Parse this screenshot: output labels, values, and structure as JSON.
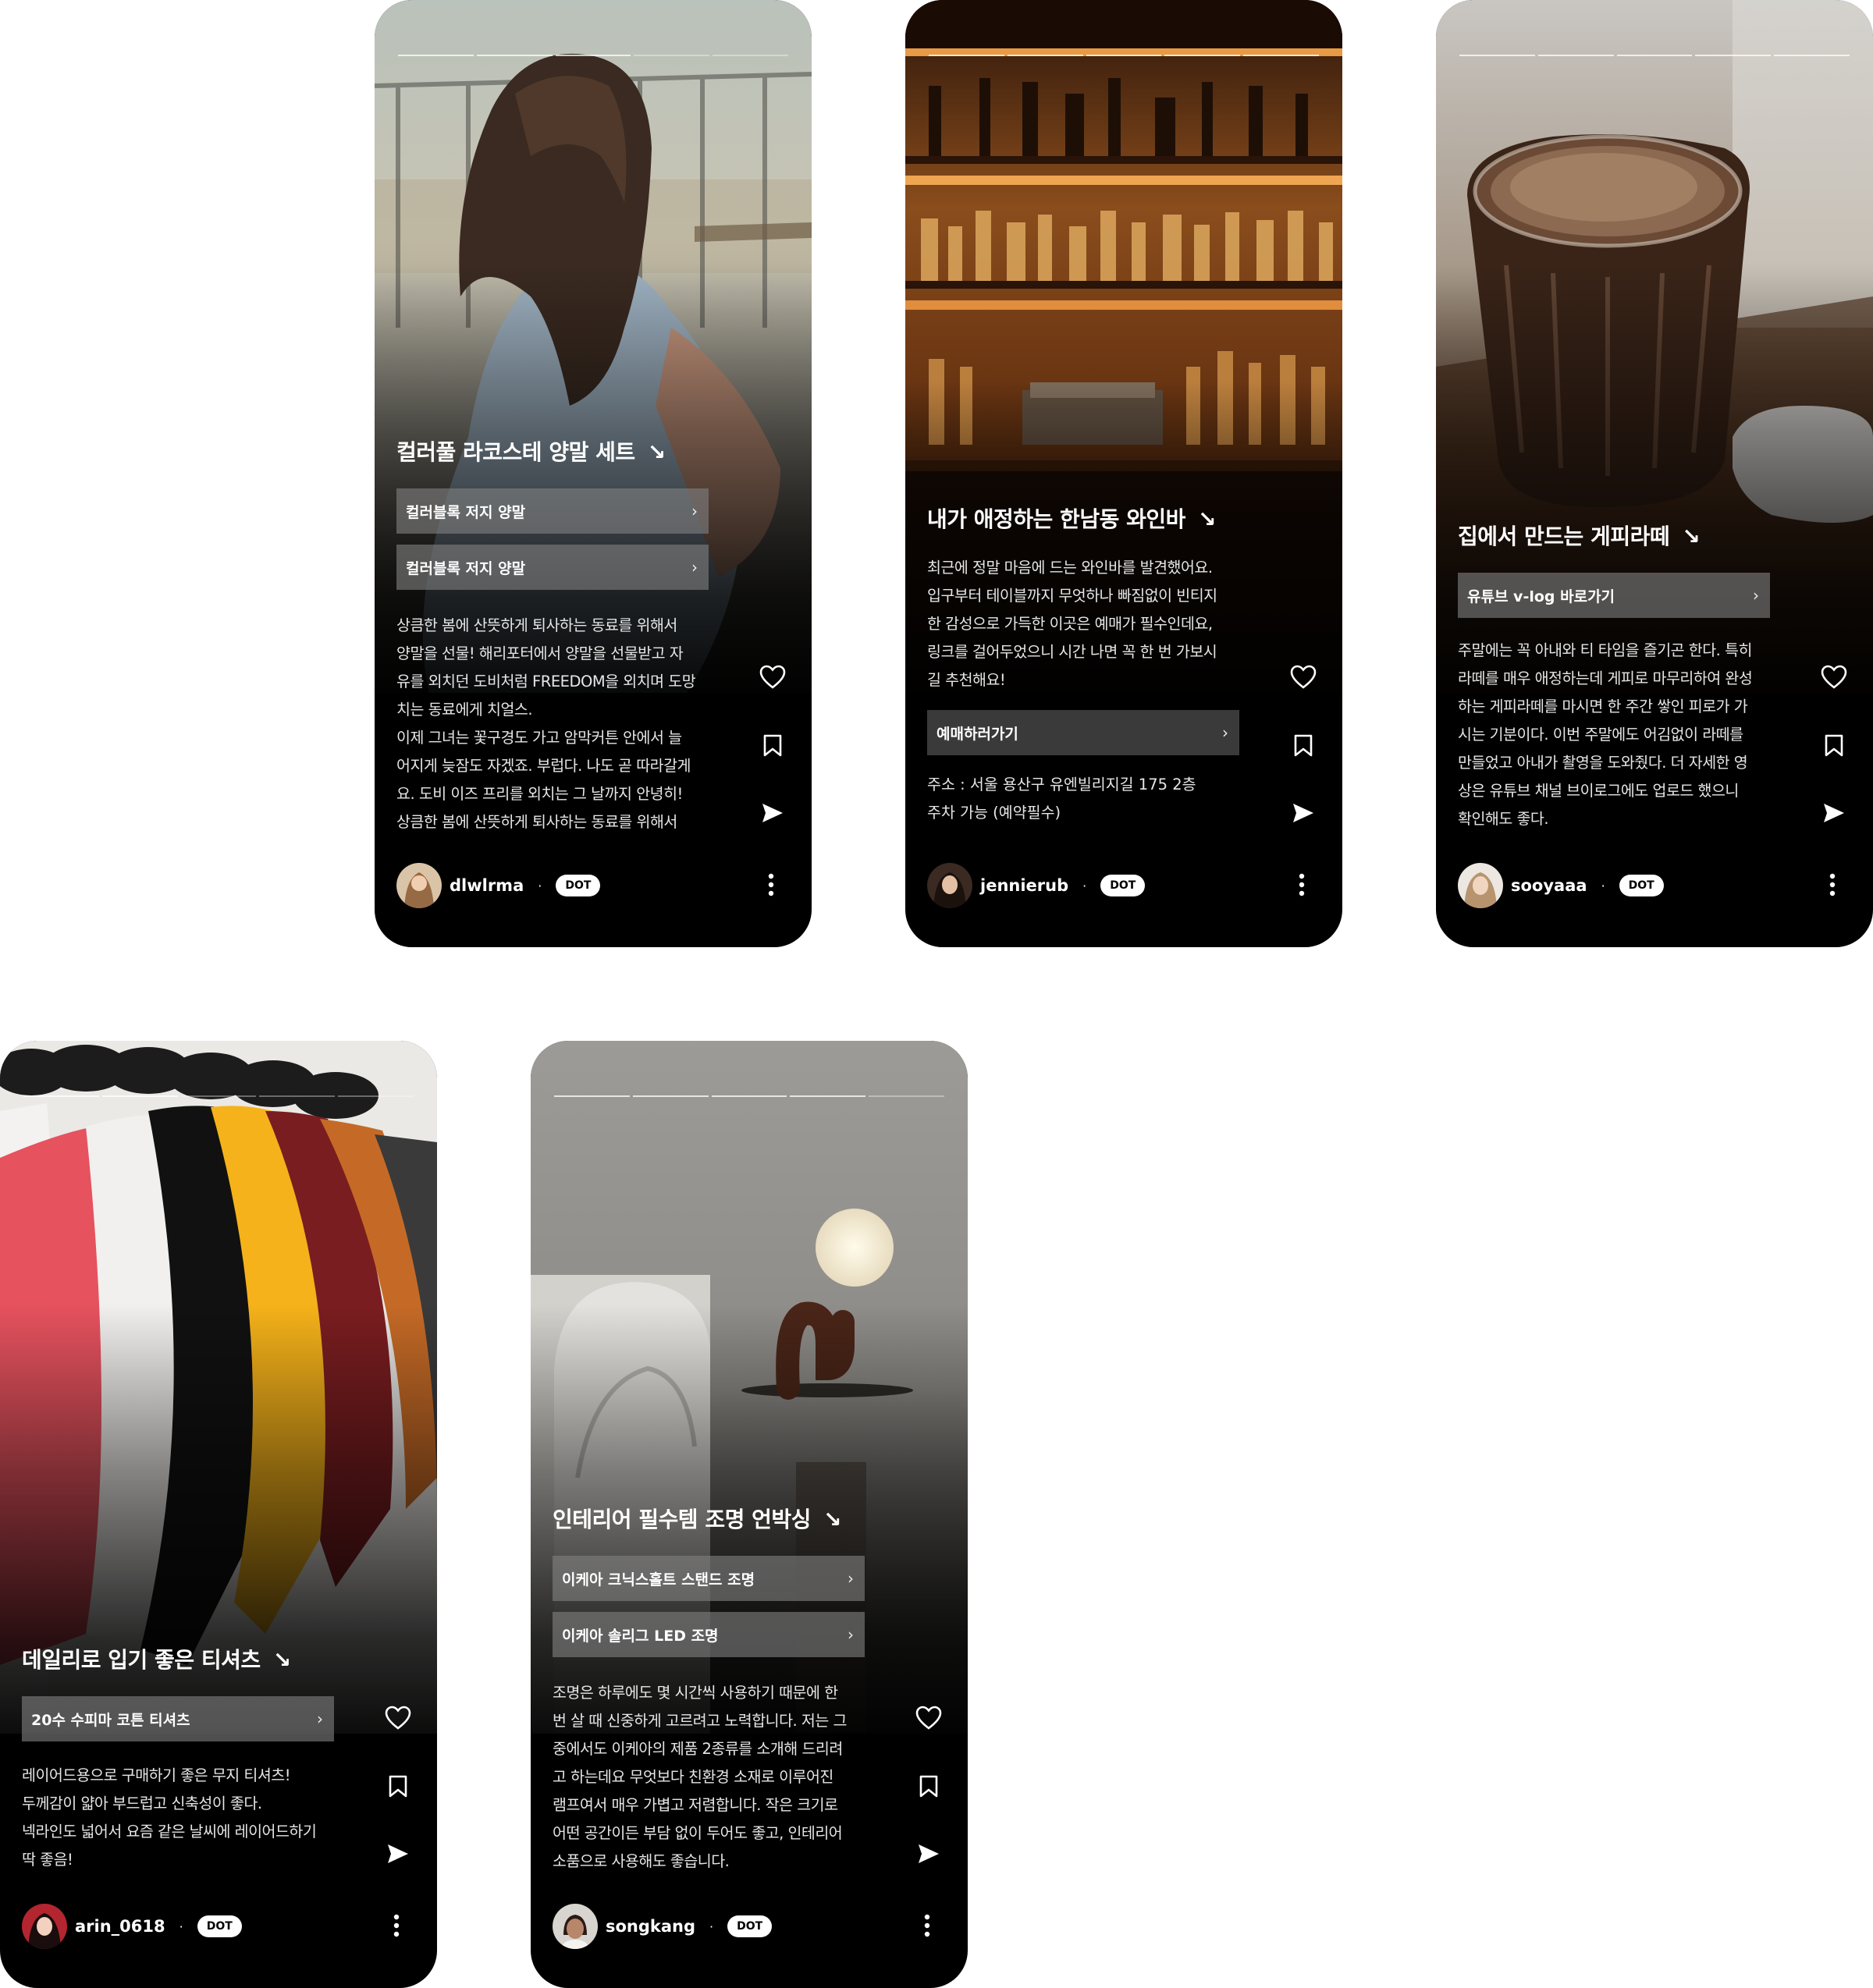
{
  "cards": [
    {
      "title": "컬러풀 라코스테 양말 세트",
      "title_arrow": "↘",
      "buttons": [
        "컬러블록 저지 양말",
        "컬러블록 저지 양말"
      ],
      "description": "상큼한 봄에 산뜻하게 퇴사하는 동료를 위해서\n양말을 선물! 해리포터에서 양말을 선물받고 자\n유를 외치던 도비처럼 FREEDOM을 외치며 도망\n치는 동료에게 치얼스.\n이제 그녀는 꽃구경도 가고 암막커튼 안에서 늘\n어지게 늦잠도 자겠죠. 부럽다. 나도 곧 따라갈게\n요. 도비 이즈 프리를 외치는 그 날까지 안녕히!\n상큼한 봄에 산뜻하게 퇴사하는 동료를 위해서",
      "username": "dlwlrma",
      "badge": "DOT"
    },
    {
      "title": "내가 애정하는 한남동 와인바",
      "title_arrow": "↘",
      "description": "최근에 정말 마음에 드는 와인바를 발견했어요.\n입구부터 테이블까지 무엇하나 빠짐없이 빈티지\n한 감성으로 가득한 이곳은 예매가 필수인데요,\n링크를 걸어두었으니 시간 나면 꼭 한 번 가보시\n길 추천해요!",
      "buttons": [
        "예매하러가기"
      ],
      "info": "주소 : 서울 용산구 유엔빌리지길 175 2층\n주차 가능 (예약필수)",
      "username": "jennierub",
      "badge": "DOT"
    },
    {
      "title": "집에서 만드는 게피라떼",
      "title_arrow": "↘",
      "buttons": [
        "유튜브 v-log 바로가기"
      ],
      "description": "주말에는 꼭 아내와 티 타임을 즐기곤 한다. 특히\n라떼를 매우 애정하는데 게피로 마무리하여 완성\n하는 게피라떼를 마시면 한 주간 쌓인 피로가 가\n시는 기분이다. 이번 주말에도 어김없이 라떼를\n만들었고 아내가 촬영을 도와줬다. 더 자세한 영\n상은 유튜브 채널 브이로그에도 업로드 했으니\n확인해도 좋다.",
      "username": "sooyaaa",
      "badge": "DOT"
    },
    {
      "title": "데일리로 입기 좋은 티셔츠",
      "title_arrow": "↘",
      "buttons": [
        "20수 수피마 코튼 티셔츠"
      ],
      "description": "레이어드용으로 구매하기 좋은 무지 티셔츠!\n두께감이 얇아 부드럽고 신축성이 좋다.\n넥라인도 넓어서 요즘 같은 날씨에 레이어드하기\n딱 좋음!",
      "username": "arin_0618",
      "badge": "DOT"
    },
    {
      "title": "인테리어 필수템 조명 언박싱",
      "title_arrow": "↘",
      "buttons": [
        "이케아 크닉스홀트 스탠드 조명",
        "이케아 솔리그 LED 조명"
      ],
      "description": "조명은 하루에도 몇 시간씩 사용하기 때문에 한\n번 살 때 신중하게 고르려고 노력합니다. 저는 그\n중에서도 이케아의 제품 2종류를 소개해 드리려\n고 하는데요 무엇보다 친환경 소재로 이루어진\n램프여서 매우 가볍고 저렴합니다. 작은 크기로\n어떤 공간이든 부담 없이 두어도 좋고, 인테리어\n소품으로 사용해도 좋습니다.",
      "username": "songkang",
      "badge": "DOT"
    }
  ],
  "separator": "·",
  "chevron": "›",
  "icons": {
    "like": "heart-icon",
    "save": "bookmark-icon",
    "share": "send-icon",
    "more": "more-vertical-icon"
  }
}
